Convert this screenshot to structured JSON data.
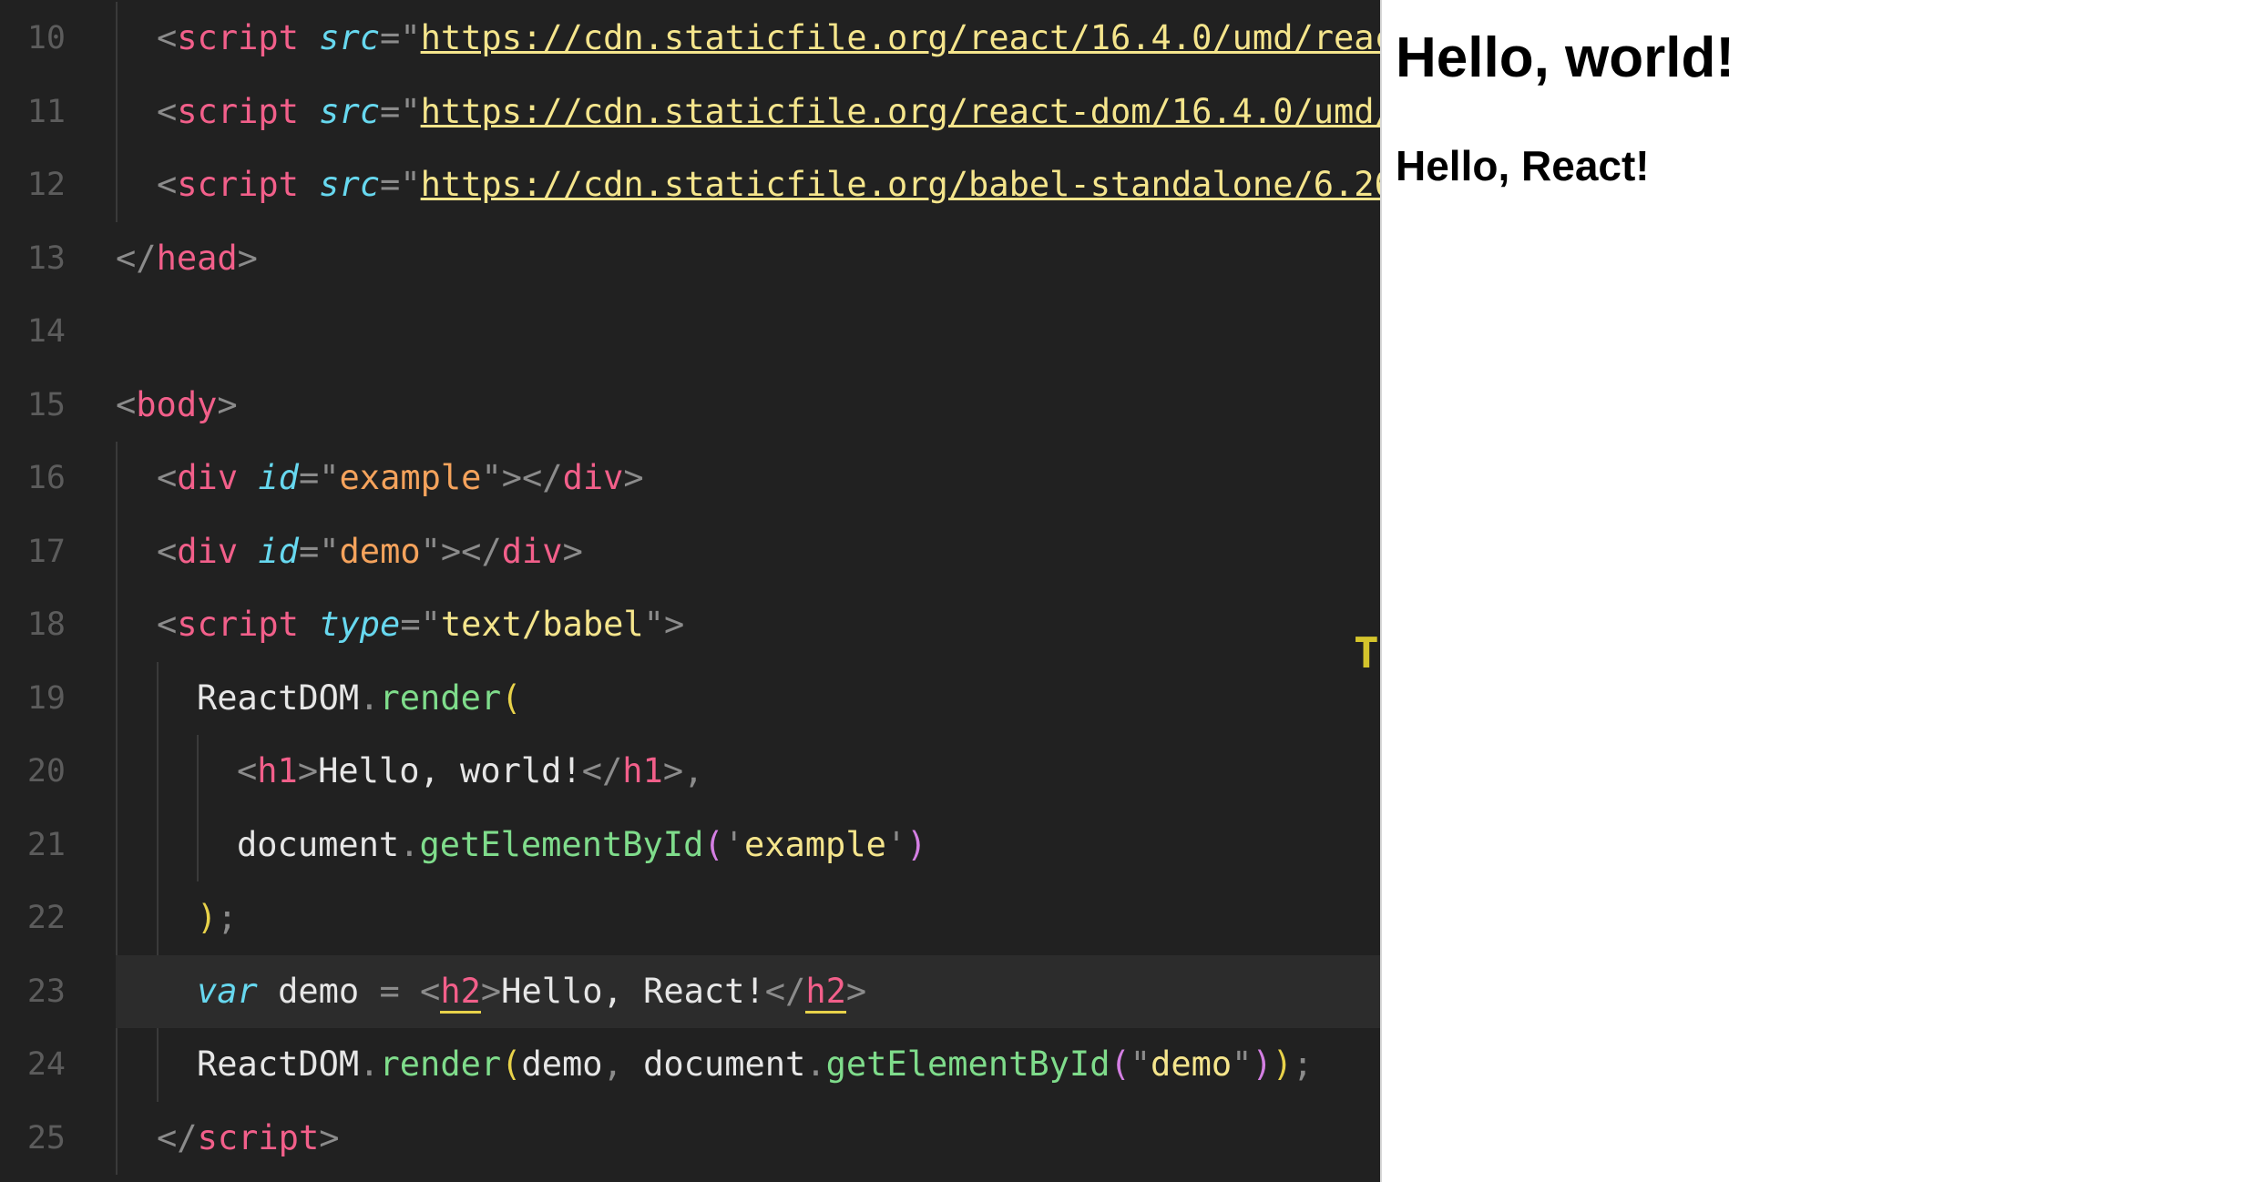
{
  "editor": {
    "lines": [
      {
        "num": "10",
        "parts": [
          [
            "p",
            "<"
          ],
          [
            "t",
            "script"
          ],
          [
            "c",
            " "
          ],
          [
            "a",
            "src"
          ],
          [
            "p",
            "="
          ],
          [
            "p",
            "\""
          ],
          [
            "url",
            "https://cdn.staticfile.org/react/16.4.0/umd/reac"
          ]
        ]
      },
      {
        "num": "11",
        "parts": [
          [
            "p",
            "<"
          ],
          [
            "t",
            "script"
          ],
          [
            "c",
            " "
          ],
          [
            "a",
            "src"
          ],
          [
            "p",
            "="
          ],
          [
            "p",
            "\""
          ],
          [
            "url",
            "https://cdn.staticfile.org/react-dom/16.4.0/umd/"
          ]
        ]
      },
      {
        "num": "12",
        "parts": [
          [
            "p",
            "<"
          ],
          [
            "t",
            "script"
          ],
          [
            "c",
            " "
          ],
          [
            "a",
            "src"
          ],
          [
            "p",
            "="
          ],
          [
            "p",
            "\""
          ],
          [
            "url",
            "https://cdn.staticfile.org/babel-standalone/6.26"
          ]
        ]
      },
      {
        "num": "13",
        "parts": [
          [
            "p",
            "</"
          ],
          [
            "t",
            "head"
          ],
          [
            "p",
            ">"
          ]
        ]
      },
      {
        "num": "14",
        "parts": []
      },
      {
        "num": "15",
        "parts": [
          [
            "p",
            "<"
          ],
          [
            "t",
            "body"
          ],
          [
            "p",
            ">"
          ]
        ]
      },
      {
        "num": "16",
        "parts": [
          [
            "p",
            "<"
          ],
          [
            "t",
            "div"
          ],
          [
            "c",
            " "
          ],
          [
            "a",
            "id"
          ],
          [
            "p",
            "="
          ],
          [
            "p",
            "\""
          ],
          [
            "s2",
            "example"
          ],
          [
            "p",
            "\""
          ],
          [
            "p",
            "></"
          ],
          [
            "t",
            "div"
          ],
          [
            "p",
            ">"
          ]
        ]
      },
      {
        "num": "17",
        "parts": [
          [
            "p",
            "<"
          ],
          [
            "t",
            "div"
          ],
          [
            "c",
            " "
          ],
          [
            "a",
            "id"
          ],
          [
            "p",
            "="
          ],
          [
            "p",
            "\""
          ],
          [
            "s2",
            "demo"
          ],
          [
            "p",
            "\""
          ],
          [
            "p",
            "></"
          ],
          [
            "t",
            "div"
          ],
          [
            "p",
            ">"
          ]
        ]
      },
      {
        "num": "18",
        "parts": [
          [
            "p",
            "<"
          ],
          [
            "t",
            "script"
          ],
          [
            "c",
            " "
          ],
          [
            "a",
            "type"
          ],
          [
            "p",
            "="
          ],
          [
            "p",
            "\""
          ],
          [
            "s",
            "text/babel"
          ],
          [
            "p",
            "\""
          ],
          [
            "p",
            ">"
          ]
        ]
      },
      {
        "num": "19",
        "parts": [
          [
            "c",
            "ReactDOM"
          ],
          [
            "p",
            "."
          ],
          [
            "f",
            "render"
          ],
          [
            "paren",
            "("
          ]
        ]
      },
      {
        "num": "20",
        "parts": [
          [
            "p",
            "<"
          ],
          [
            "t",
            "h1"
          ],
          [
            "p",
            ">"
          ],
          [
            "c",
            "Hello, world!"
          ],
          [
            "p",
            "</"
          ],
          [
            "t",
            "h1"
          ],
          [
            "p",
            ">"
          ],
          [
            "p",
            ","
          ]
        ]
      },
      {
        "num": "21",
        "parts": [
          [
            "c",
            "document"
          ],
          [
            "p",
            "."
          ],
          [
            "f",
            "getElementById"
          ],
          [
            "paren2",
            "("
          ],
          [
            "p",
            "'"
          ],
          [
            "s",
            "example"
          ],
          [
            "p",
            "'"
          ],
          [
            "paren2",
            ")"
          ]
        ]
      },
      {
        "num": "22",
        "parts": [
          [
            "paren",
            ")"
          ],
          [
            "p",
            ";"
          ]
        ]
      },
      {
        "num": "23",
        "parts": [
          [
            "kw",
            "var"
          ],
          [
            "c",
            " demo "
          ],
          [
            "p",
            "="
          ],
          [
            "c",
            " "
          ],
          [
            "p",
            "<"
          ],
          [
            "tm",
            "h2"
          ],
          [
            "p",
            ">"
          ],
          [
            "c",
            "Hello, React!"
          ],
          [
            "p",
            "</"
          ],
          [
            "tm",
            "h2"
          ],
          [
            "p",
            ">"
          ]
        ]
      },
      {
        "num": "24",
        "parts": [
          [
            "c",
            "ReactDOM"
          ],
          [
            "p",
            "."
          ],
          [
            "f",
            "render"
          ],
          [
            "paren",
            "("
          ],
          [
            "c",
            "demo"
          ],
          [
            "p",
            ", "
          ],
          [
            "c",
            "document"
          ],
          [
            "p",
            "."
          ],
          [
            "f",
            "getElementById"
          ],
          [
            "paren2",
            "("
          ],
          [
            "p",
            "\""
          ],
          [
            "s",
            "demo"
          ],
          [
            "p",
            "\""
          ],
          [
            "paren2",
            ")"
          ],
          [
            "paren",
            ")"
          ],
          [
            "p",
            ";"
          ]
        ]
      },
      {
        "num": "25",
        "parts": [
          [
            "p",
            "</"
          ],
          [
            "t",
            "script"
          ],
          [
            "p",
            ">"
          ]
        ]
      }
    ],
    "stray_glyph": "T"
  },
  "preview": {
    "heading1": "Hello, world!",
    "heading2": "Hello, React!"
  },
  "colors": {
    "editor_bg": "#212121",
    "tag": "#f25f8a",
    "attribute": "#67d8ef",
    "string": "#f5e58c",
    "function": "#7fdc8b"
  }
}
